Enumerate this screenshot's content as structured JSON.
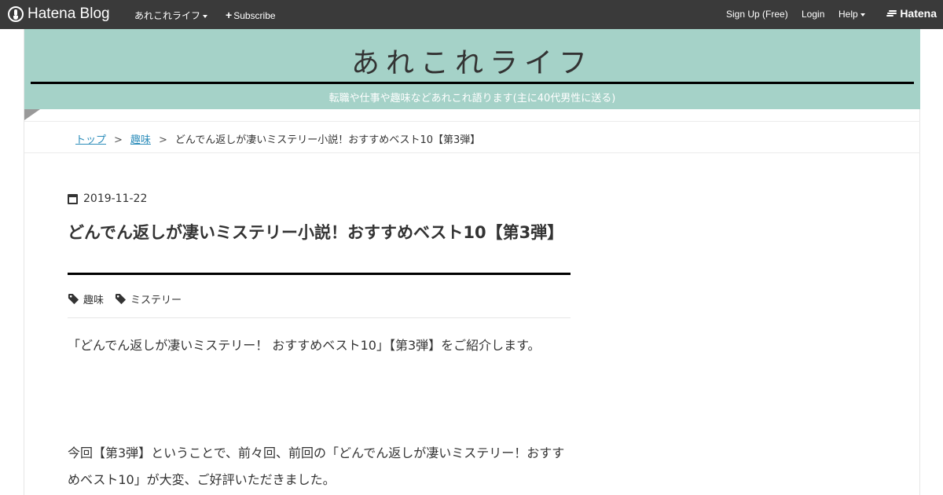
{
  "navbar": {
    "logo_text": "Hatena Blog",
    "blog_menu": "あれこれライフ",
    "subscribe": "Subscribe",
    "signup": "Sign Up (Free)",
    "login": "Login",
    "help": "Help",
    "hatena": "Hatena"
  },
  "header": {
    "title": "あれこれライフ",
    "description": "転職や仕事や趣味などあれこれ語ります(主に40代男性に送る)",
    "bg_color": "#a5d2c8"
  },
  "breadcrumb": {
    "top": "トップ",
    "separator": ">",
    "category": "趣味",
    "current": "どんでん返しが凄いミステリー小説！おすすめベスト10【第3弾】"
  },
  "article": {
    "date": "2019-11-22",
    "title": "どんでん返しが凄いミステリー小説！おすすめベスト10【第3弾】",
    "tags": [
      "趣味",
      "ミステリー"
    ],
    "paragraphs": [
      "「どんでん返しが凄いミステリー！ おすすめベスト10」【第3弾】をご紹介します。",
      "今回【第3弾】ということで、前々回、前回の「どんでん返しが凄いミステリー！おすすめベスト10」が大変、ご好評いただきました。"
    ]
  },
  "icons": {
    "logo": "hatena-blog-logo-icon",
    "calendar": "calendar-icon",
    "tag": "tag-icon"
  }
}
